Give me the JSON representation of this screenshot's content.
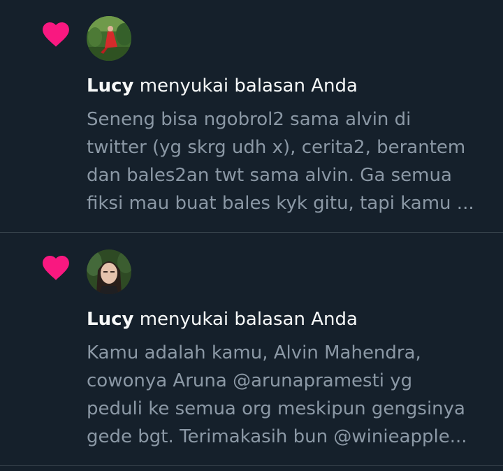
{
  "notifications": [
    {
      "user": "Lucy",
      "action": "menyukai balasan Anda",
      "snippet_lines": [
        "Seneng bisa ngobrol2 sama alvin di",
        "twitter (yg skrg udh x), cerita2, berantem",
        "dan bales2an twt sama alvin. Ga semua",
        "fiksi mau buat bales kyk gitu, tapi kamu ..."
      ],
      "icon": "heart-icon"
    },
    {
      "user": "Lucy",
      "action": "menyukai balasan Anda",
      "snippet_lines": [
        "Kamu adalah kamu, Alvin Mahendra,",
        "cowonya Aruna @arunapramesti yg",
        "peduli ke semua org meskipun gengsinya",
        "gede bgt. Terimakasih bun @winieapple..."
      ],
      "icon": "heart-icon"
    }
  ],
  "colors": {
    "background": "#15202b",
    "heart": "#f91880",
    "primary_text": "#f7f9f9",
    "secondary_text": "#8b98a5",
    "divider": "#38444d"
  }
}
